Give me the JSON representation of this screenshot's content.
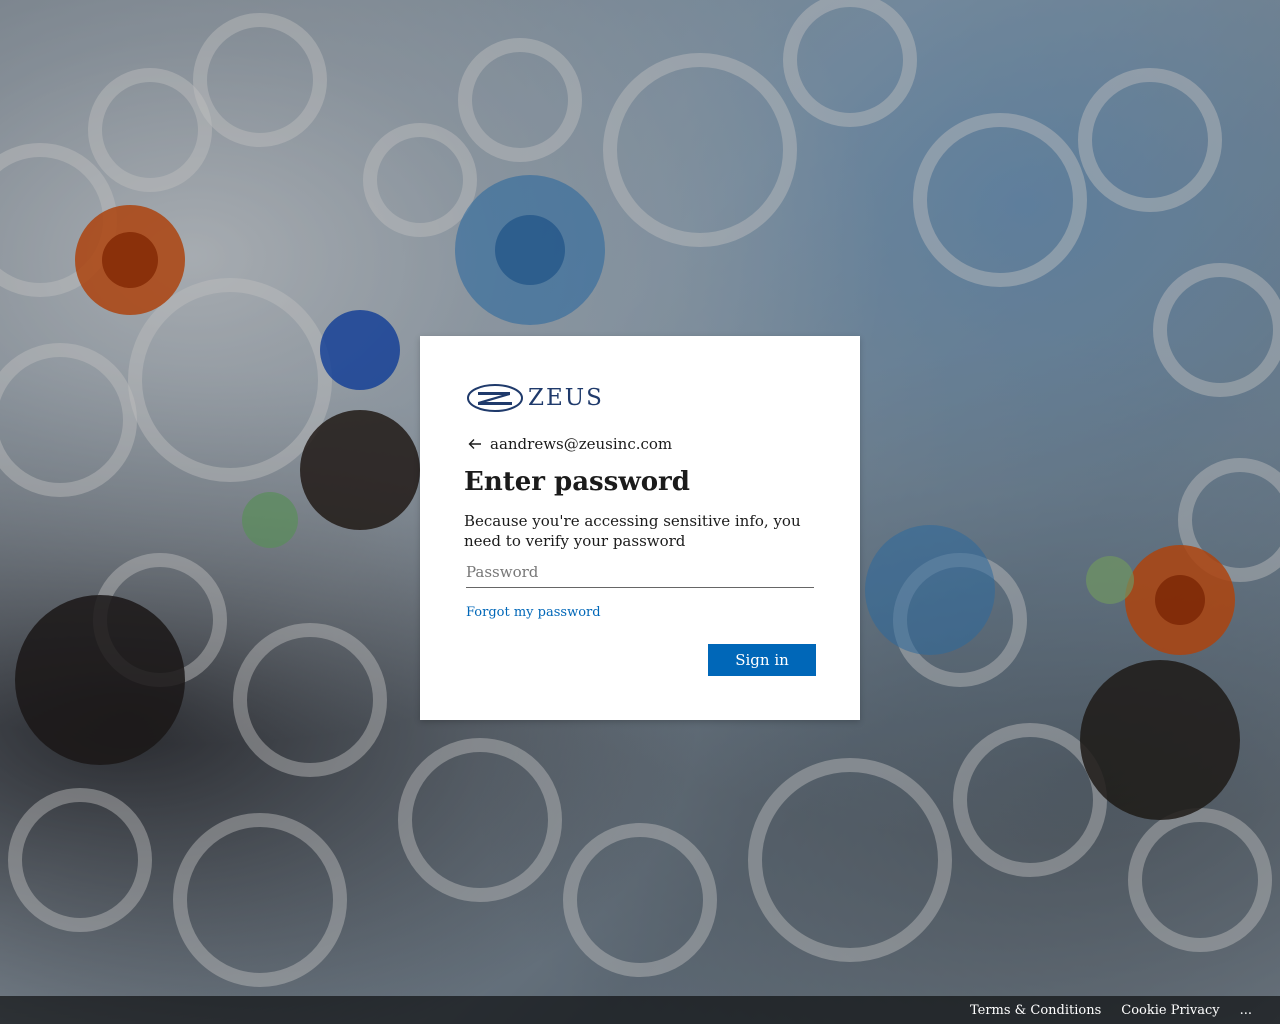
{
  "brand": {
    "logo_text": "ZEUS",
    "logo_icon": "zeus-logo-icon",
    "logo_color": "#1f3a6b"
  },
  "identity": {
    "back_icon": "arrow-left-icon",
    "email": "aandrews@zeusinc.com"
  },
  "form": {
    "title": "Enter password",
    "description": "Because you're accessing sensitive info, you need to verify your password",
    "password_placeholder": "Password",
    "password_value": "",
    "forgot_link": "Forgot my password",
    "submit_label": "Sign in"
  },
  "footer": {
    "links": [
      "Terms & Conditions",
      "Cookie Privacy",
      "..."
    ]
  },
  "colors": {
    "accent": "#0067b8",
    "footer_bg": "rgba(0,0,0,0.6)"
  }
}
